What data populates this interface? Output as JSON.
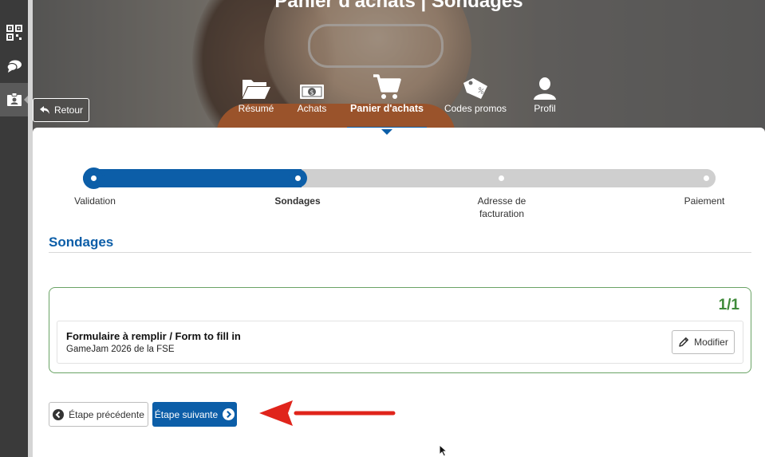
{
  "page": {
    "title": "Panier d'achats | Sondages"
  },
  "sidebar": {
    "items": [
      {
        "icon": "qr-code-icon",
        "active": false
      },
      {
        "icon": "chat-bubbles-icon",
        "active": false
      },
      {
        "icon": "id-card-icon",
        "active": true
      }
    ]
  },
  "back_button": {
    "label": "Retour",
    "icon": "arrow-back-icon"
  },
  "tabs": [
    {
      "label": "Résumé",
      "icon": "folder-open-icon",
      "active": false
    },
    {
      "label": "Achats",
      "icon": "money-bill-icon",
      "active": false
    },
    {
      "label": "Panier d'achats",
      "icon": "shopping-cart-icon",
      "active": true
    },
    {
      "label": "Codes promos",
      "icon": "tag-icon",
      "active": false
    },
    {
      "label": "Profil",
      "icon": "user-icon",
      "active": false
    }
  ],
  "steps": [
    {
      "label": "Validation",
      "state": "done"
    },
    {
      "label": "Sondages",
      "state": "current"
    },
    {
      "label_line1": "Adresse de",
      "label_line2": "facturation",
      "state": "todo"
    },
    {
      "label": "Paiement",
      "state": "todo"
    }
  ],
  "progress": {
    "completed_fraction": 0.333
  },
  "section": {
    "title": "Sondages"
  },
  "survey": {
    "count": "1/1",
    "name": "Formulaire à remplir / Form to fill in",
    "event": "GameJam 2026 de la FSE",
    "modify_label": "Modifier",
    "status_color": "#3f8a3a"
  },
  "nav": {
    "prev_label": "Étape précédente",
    "next_label": "Étape suivante"
  },
  "colors": {
    "accent": "#0c5ea8",
    "annotation": "#e0241b"
  }
}
